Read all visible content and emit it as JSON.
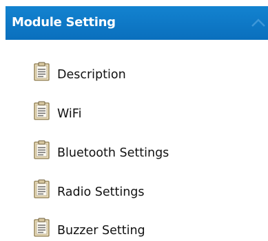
{
  "panel": {
    "title": "Module Setting",
    "header_color": "#0a75c5",
    "collapse_icon": "chevron-up-icon"
  },
  "menu": {
    "item_icon": "document-icon",
    "items": [
      {
        "label": "Description"
      },
      {
        "label": "WiFi"
      },
      {
        "label": "Bluetooth Settings"
      },
      {
        "label": "Radio Settings"
      },
      {
        "label": "Buzzer Setting"
      }
    ]
  }
}
